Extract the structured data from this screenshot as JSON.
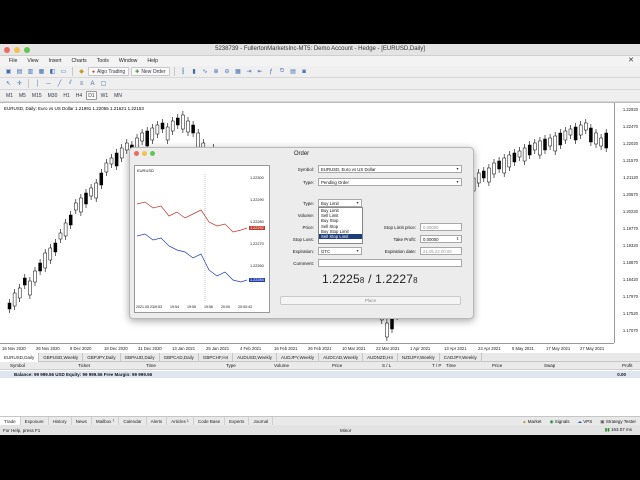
{
  "window": {
    "title": "5238739 - FullertonMarketsInc-MT5: Demo Account - Hedge - [EURUSD,Daily]"
  },
  "menu": [
    "File",
    "View",
    "Insert",
    "Charts",
    "Tools",
    "Window",
    "Help"
  ],
  "toolbar": {
    "algo_trading": "Algo Trading",
    "new_order": "New Order"
  },
  "timeframes": [
    "M1",
    "M5",
    "M15",
    "M30",
    "H1",
    "H4",
    "D1",
    "W1",
    "MN"
  ],
  "chart": {
    "label": "EURUSD, Daily: Euro vs US Dollar 1.21991 1.22055 1.21621 1.22153",
    "y_ticks": [
      "1.22920",
      "1.22470",
      "1.22020",
      "1.21570",
      "1.21120",
      "1.20670",
      "1.20220",
      "1.19770",
      "1.19320",
      "1.18870",
      "1.18420",
      "1.17970",
      "1.17520",
      "1.17070"
    ],
    "x_ticks": [
      "16 Nov 2020",
      "26 Nov 2020",
      "8 Dec 2020",
      "18 Dec 2020",
      "31 Dec 2020",
      "13 Jan 2021",
      "25 Jan 2021",
      "4 Feb 2021",
      "16 Feb 2021",
      "26 Feb 2021",
      "10 Mar 2021",
      "22 Mar 2021",
      "1 Apr 2021",
      "13 Apr 2021",
      "23 Apr 2021",
      "5 May 2021",
      "17 May 2021",
      "27 May 2021"
    ],
    "colors": {
      "bull": "#ffffff",
      "bear": "#000000",
      "candle_outline": "#000000"
    }
  },
  "chart_tabs": [
    "EURUSD,Daily",
    "GBPUSD,Weekly",
    "GBPJPY,Daily",
    "GBPAUD,Daily",
    "GBPCAD,Daily",
    "GBPCHF,H4",
    "AUDUSD,Weekly",
    "AUDJPY,Weekly",
    "AUDCAD,Weekly",
    "AUDNZD,H4",
    "NZDJPY,Weekly",
    "CADJPY,Weekly"
  ],
  "terminal": {
    "columns": [
      "Symbol",
      "Ticket",
      "Time",
      "Type",
      "Volume",
      "Price",
      "S / L",
      "T / P",
      "Time",
      "Price",
      "Swap",
      "Profit"
    ],
    "balance": "Balance: 99 999.56 USD  Equity: 99 999.56  Free Margin: 99 999.56",
    "balance_value": "0.00"
  },
  "bottom_tabs": [
    "Trade",
    "Exposure",
    "History",
    "News",
    "Mailbox",
    "Calendar",
    "Alerts",
    "Articles",
    "Code Base",
    "Experts",
    "Journal"
  ],
  "bottom_mailbox_count": "7",
  "bottom_articles_count": "1",
  "bottom_right": [
    "Market",
    "Signals",
    "VPS",
    "Strategy Tester"
  ],
  "status": {
    "help": "For Help, press F1",
    "profile": "Minor",
    "traffic": "163.07 ms"
  },
  "order": {
    "title": "Order",
    "mini_label": "EURUSD",
    "mini_y": [
      "1.22300",
      "1.22290",
      "1.22280",
      "1.22270",
      "1.22260"
    ],
    "mini_ask": "1.22292",
    "mini_bid": "1.22284",
    "mini_x": [
      "2021.05.21",
      "19:53",
      "19:54",
      "19:55",
      "19:56",
      "20:00",
      "20:00:43"
    ],
    "symbol_label": "Symbol:",
    "symbol_value": "EURUSD, Euro vs US Dollar",
    "type_label": "Type:",
    "type_value": "Pending Order",
    "ptype_label": "Type:",
    "ptype_value": "Buy Limit",
    "volume_label": "Volume:",
    "price_label": "Price:",
    "stop_loss_label": "Stop Loss:",
    "stop_loss_value": "0.00000",
    "expiration_label": "Expiration:",
    "expiration_value": "GTC",
    "comment_label": "Comment:",
    "stop_limit_label": "Stop Limit price:",
    "stop_limit_value": "0.00000",
    "take_profit_label": "Take Profit:",
    "take_profit_value": "0.00000",
    "exp_date_label": "Expiration date:",
    "exp_date_value": "21.05.22 00:00",
    "dropdown": [
      "Buy Limit",
      "Sell Limit",
      "Buy Stop",
      "Sell Stop",
      "Buy Stop Limit",
      "Sell Stop Limit"
    ],
    "bid_main": "1.2225",
    "bid_small": "8",
    "sep": " / ",
    "ask_main": "1.2227",
    "ask_small": "8",
    "place_button": "Place"
  }
}
